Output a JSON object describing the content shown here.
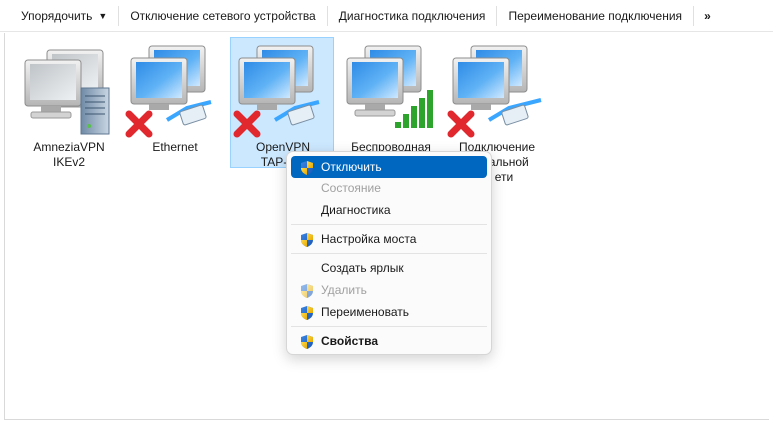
{
  "toolbar": {
    "organize": "Упорядочить",
    "disable_device": "Отключение сетевого устройства",
    "diagnose": "Диагностика подключения",
    "rename": "Переименование подключения",
    "more": "»"
  },
  "connections": [
    {
      "line1": "AmneziaVPN",
      "line2": "IKEv2",
      "icon": "vpn-server-icon",
      "status": "connected"
    },
    {
      "line1": "Ethernet",
      "line2": "",
      "icon": "ethernet-icon",
      "status": "disconnected"
    },
    {
      "line1": "OpenVPN",
      "line2": "TAP-Wir",
      "icon": "ethernet-icon",
      "status": "disconnected"
    },
    {
      "line1": "Беспроводная",
      "line2": "",
      "icon": "wifi-icon",
      "status": "connected"
    },
    {
      "line1": "Подключение",
      "line2": "кальной",
      "line3": "ети",
      "icon": "ethernet-icon",
      "status": "disconnected"
    }
  ],
  "context_menu": {
    "items": [
      {
        "label": "Отключить",
        "shield": true,
        "disabled": false,
        "bold": false,
        "highlighted": true
      },
      {
        "label": "Состояние",
        "shield": false,
        "disabled": true,
        "bold": false
      },
      {
        "label": "Диагностика",
        "shield": false,
        "disabled": false,
        "bold": false
      },
      {
        "label": "Настройка моста",
        "shield": true,
        "disabled": false,
        "bold": false
      },
      {
        "label": "Создать ярлык",
        "shield": false,
        "disabled": false,
        "bold": false
      },
      {
        "label": "Удалить",
        "shield": true,
        "disabled": true,
        "bold": false
      },
      {
        "label": "Переименовать",
        "shield": true,
        "disabled": false,
        "bold": false
      },
      {
        "label": "Свойства",
        "shield": true,
        "disabled": false,
        "bold": true
      }
    ]
  },
  "colors": {
    "selection": "#cce8ff",
    "menu_highlight": "#0067c0",
    "error_x": "#e0282e",
    "signal_green": "#2da52d"
  }
}
